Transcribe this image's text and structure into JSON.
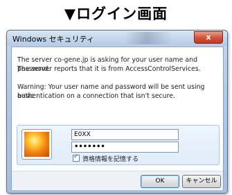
{
  "caption": "▼ログイン画面",
  "dialog": {
    "title": "Windows セキュリティ",
    "close_label": "x",
    "message_lines": [
      "The server co-gene.jp is asking for your user name and password.",
      "The server reports that it is from AccessControlServices.",
      "Warning: Your user name and password will be sent using basic",
      "authentication on a connection that isn't secure."
    ],
    "username_value": "E0XX",
    "password_value": "•••••••",
    "remember_label": "資格情報を記憶する",
    "remember_checked": true,
    "ok_label": "OK",
    "cancel_label": "キャンセル"
  },
  "colors": {
    "frame": "#b3c9e3",
    "close_button": "#c23a20",
    "ok_border": "#3c7fb1"
  },
  "icons": {
    "user_tile": "user-picture-icon",
    "checkbox_tick": "check-icon"
  }
}
